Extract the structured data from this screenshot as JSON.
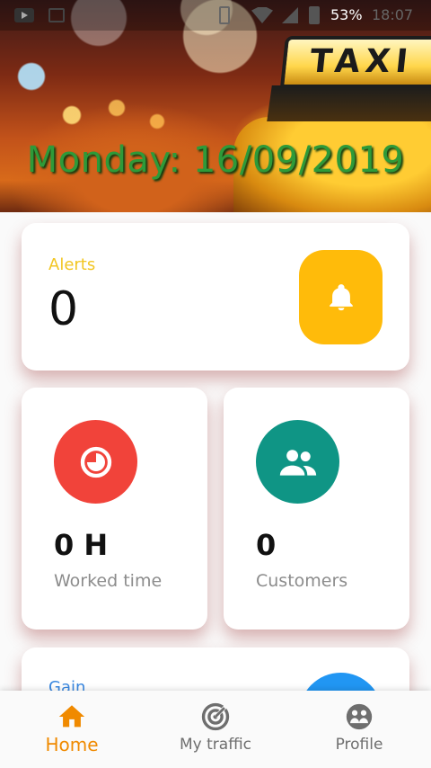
{
  "status_bar": {
    "battery_percent": "53%",
    "time": "18:07",
    "icons": [
      "youtube-icon",
      "image-icon",
      "vibrate-icon",
      "wifi-icon",
      "no-signal-icon",
      "battery-icon"
    ]
  },
  "header": {
    "date_title": "Monday: 16/09/2019",
    "taxi_sign_text": "TAXI"
  },
  "alerts": {
    "label": "Alerts",
    "value": "0",
    "icon": "bell-icon",
    "color": "#ffbb0a"
  },
  "worked_time": {
    "value": "0 H",
    "label": "Worked time",
    "icon": "clock-icon",
    "color": "#f1433a"
  },
  "customers": {
    "value": "0",
    "label": "Customers",
    "icon": "people-icon",
    "color": "#0f9585"
  },
  "gain": {
    "label": "Gain",
    "color": "#2196f3"
  },
  "bottom_nav": {
    "items": [
      {
        "label": "Home",
        "icon": "home-icon",
        "active": true
      },
      {
        "label": "My traffic",
        "icon": "radar-icon",
        "active": false
      },
      {
        "label": "Profile",
        "icon": "profile-icon",
        "active": false
      }
    ],
    "active_color": "#f08a00"
  }
}
